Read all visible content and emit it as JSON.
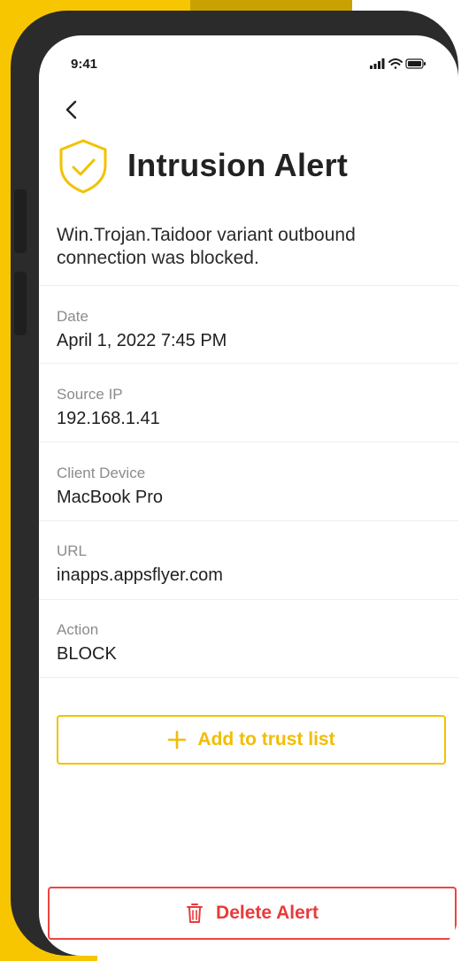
{
  "colors": {
    "accent": "#F2C200",
    "danger": "#E83B3B",
    "background_brand": "#F7C600"
  },
  "status_bar": {
    "time": "9:41",
    "icons": [
      "signal-icon",
      "wifi-icon",
      "battery-icon"
    ]
  },
  "header": {
    "back_icon": "chevron-left-icon",
    "shield_icon": "shield-check-icon",
    "title": "Intrusion Alert"
  },
  "alert": {
    "description": "Win.Trojan.Taidoor variant outbound connection was blocked."
  },
  "fields": [
    {
      "label": "Date",
      "value": "April 1, 2022 7:45 PM"
    },
    {
      "label": "Source IP",
      "value": "192.168.1.41"
    },
    {
      "label": "Client Device",
      "value": "MacBook Pro"
    },
    {
      "label": "URL",
      "value": "inapps.appsflyer.com"
    },
    {
      "label": "Action",
      "value": "BLOCK"
    }
  ],
  "actions": {
    "trust": {
      "label": "Add to trust list",
      "icon": "plus-icon"
    },
    "delete": {
      "label": "Delete Alert",
      "icon": "trash-icon"
    }
  }
}
